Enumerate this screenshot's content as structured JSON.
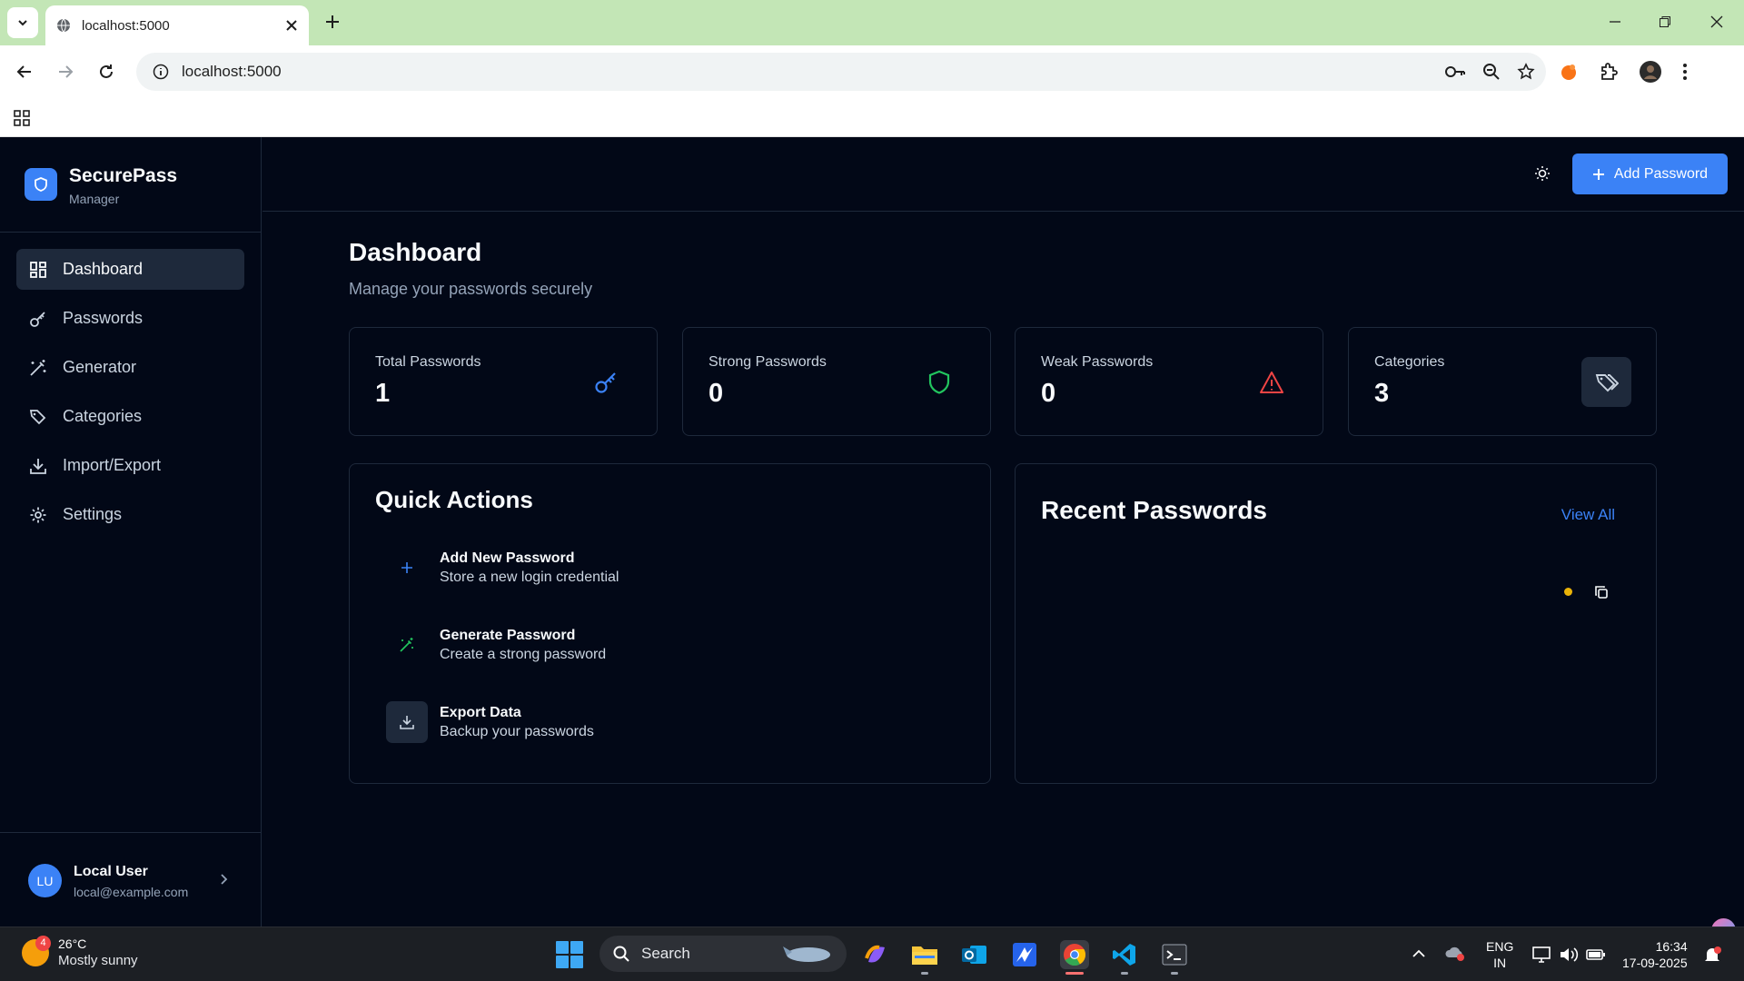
{
  "browser": {
    "tab_title": "localhost:5000",
    "url": "localhost:5000"
  },
  "app": {
    "brand_name": "SecurePass",
    "brand_sub": "Manager",
    "nav": [
      {
        "label": "Dashboard",
        "icon": "grid-icon",
        "active": true
      },
      {
        "label": "Passwords",
        "icon": "key-icon",
        "active": false
      },
      {
        "label": "Generator",
        "icon": "wand-icon",
        "active": false
      },
      {
        "label": "Categories",
        "icon": "tags-icon",
        "active": false
      },
      {
        "label": "Import/Export",
        "icon": "download-icon",
        "active": false
      },
      {
        "label": "Settings",
        "icon": "gear-icon",
        "active": false
      }
    ],
    "user": {
      "initials": "LU",
      "name": "Local User",
      "email": "local@example.com"
    },
    "add_button_label": "Add Password",
    "page_title": "Dashboard",
    "page_subtitle": "Manage your passwords securely",
    "stats": [
      {
        "label": "Total Passwords",
        "value": "1",
        "icon": "key-icon",
        "color": "#3b82f6"
      },
      {
        "label": "Strong Passwords",
        "value": "0",
        "icon": "shield-icon",
        "color": "#22c55e"
      },
      {
        "label": "Weak Passwords",
        "value": "0",
        "icon": "warning-icon",
        "color": "#ef4444"
      },
      {
        "label": "Categories",
        "value": "3",
        "icon": "tags-icon",
        "color": "#cbd5e1"
      }
    ],
    "quick_actions": {
      "title": "Quick Actions",
      "items": [
        {
          "title": "Add New Password",
          "subtitle": "Store a new login credential",
          "icon": "plus-icon"
        },
        {
          "title": "Generate Password",
          "subtitle": "Create a strong password",
          "icon": "wand-icon"
        },
        {
          "title": "Export Data",
          "subtitle": "Backup your passwords",
          "icon": "download-icon"
        }
      ]
    },
    "recent": {
      "title": "Recent Passwords",
      "view_all": "View All"
    },
    "colors": {
      "accent": "#3b82f6",
      "background": "#020817",
      "border": "#1e293b",
      "weak": "#eab308"
    }
  },
  "taskbar": {
    "weather_badge": "4",
    "weather_temp": "26°C",
    "weather_desc": "Mostly sunny",
    "search_label": "Search",
    "lang_line1": "ENG",
    "lang_line2": "IN",
    "time": "16:34",
    "date": "17-09-2025"
  }
}
